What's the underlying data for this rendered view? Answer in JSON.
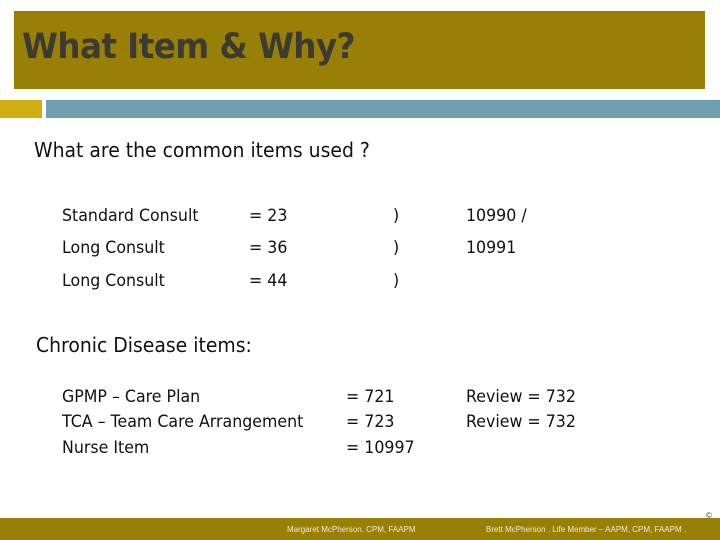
{
  "slide": {
    "title": "What Item & Why?"
  },
  "common_items": {
    "heading": "What are the common items used ?",
    "rows": [
      {
        "label": "Standard Consult",
        "value": "= 23",
        "bracket": ")"
      },
      {
        "label": "Long Consult",
        "value": "= 36",
        "bracket": ")"
      },
      {
        "label": "Long Consult",
        "value": "= 44",
        "bracket": ")"
      }
    ],
    "codes": [
      "10990 /",
      "10991"
    ]
  },
  "chronic_disease": {
    "heading": "Chronic Disease items:",
    "rows": [
      {
        "label": "GPMP – Care Plan",
        "value": "= 721"
      },
      {
        "label": "TCA – Team Care Arrangement",
        "value": "= 723"
      },
      {
        "label": "Nurse Item",
        "value": "= 10997"
      }
    ],
    "reviews": [
      "Review = 732",
      "Review = 732"
    ]
  },
  "footer": {
    "left_text": "Margaret McPherson. CPM, FAAPM",
    "right_text": "Brett McPherson . Life Member – AAPM, CPM, FAAPM .",
    "copyright": "©"
  },
  "colors": {
    "title_bar": "#987f05",
    "accent_gold": "#d1af10",
    "accent_teal": "#719faf",
    "title_text": "#3b3a33"
  }
}
